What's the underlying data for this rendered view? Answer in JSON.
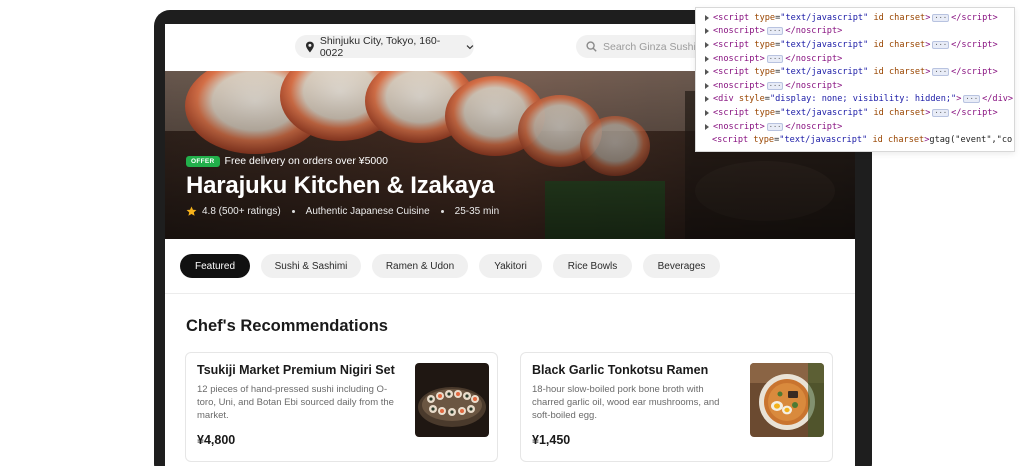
{
  "topbar": {
    "location": "Shinjuku City, Tokyo, 160-0022",
    "search_placeholder": "Search Ginza Sushi..."
  },
  "hero": {
    "offer_badge": "OFFER",
    "offer_text": "Free delivery on orders over ¥5000",
    "restaurant_name": "Harajuku Kitchen & Izakaya",
    "rating": "4.8 (500+ ratings)",
    "cuisine": "Authentic Japanese Cuisine",
    "delivery_time": "25-35 min"
  },
  "tabs": [
    {
      "label": "Featured",
      "active": true
    },
    {
      "label": "Sushi & Sashimi",
      "active": false
    },
    {
      "label": "Ramen & Udon",
      "active": false
    },
    {
      "label": "Yakitori",
      "active": false
    },
    {
      "label": "Rice Bowls",
      "active": false
    },
    {
      "label": "Beverages",
      "active": false
    }
  ],
  "section_title": "Chef's Recommendations",
  "cards": [
    {
      "title": "Tsukiji Market Premium Nigiri Set",
      "description": "12 pieces of hand-pressed sushi including O-toro, Uni, and Botan Ebi sourced daily from the market.",
      "price": "¥4,800"
    },
    {
      "title": "Black Garlic Tonkotsu Ramen",
      "description": "18-hour slow-boiled pork bone broth with charred garlic oil, wood ear mushrooms, and soft-boiled egg.",
      "price": "¥1,450"
    }
  ],
  "devtools": {
    "lines": [
      {
        "kind": "script",
        "text_script": "script",
        "text_type": "type",
        "text_type_val": "\"text/javascript\"",
        "text_id": "id",
        "text_charset": "charset"
      },
      {
        "kind": "noscript",
        "text": "noscript"
      },
      {
        "kind": "script"
      },
      {
        "kind": "noscript"
      },
      {
        "kind": "script"
      },
      {
        "kind": "noscript"
      },
      {
        "kind": "div"
      },
      {
        "kind": "script"
      },
      {
        "kind": "noscript"
      },
      {
        "kind": "gtag"
      }
    ],
    "div_style": "\"display: none; visibility: hidden;\"",
    "gtag_text": "gtag(\"event\",\"co"
  },
  "colors": {
    "offer_green": "#22b04b",
    "active_tab": "#111111",
    "tag": "#881280",
    "attr": "#994500",
    "value": "#1a1aa6"
  }
}
